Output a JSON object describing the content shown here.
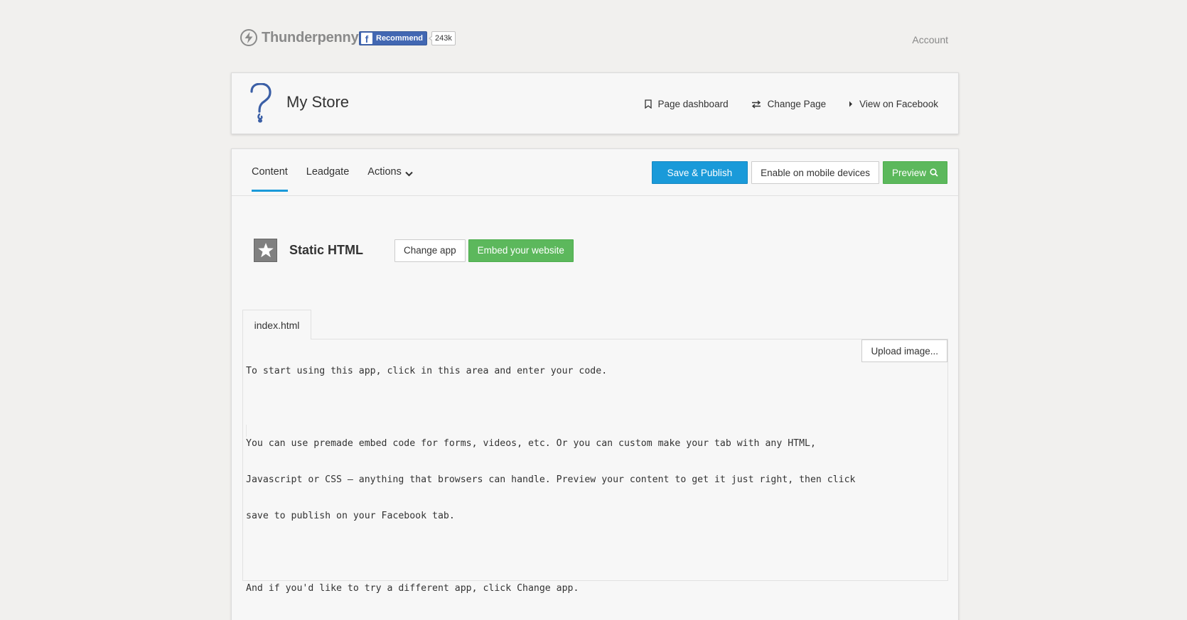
{
  "brand": {
    "name": "Thunderpenny"
  },
  "facebook": {
    "recommend_label": "Recommend",
    "count": "243k"
  },
  "topnav": {
    "account": "Account"
  },
  "page": {
    "store_name": "My Store",
    "nav": [
      {
        "label": "Page dashboard",
        "icon": "bookmark-icon"
      },
      {
        "label": "Change Page",
        "icon": "swap-arrows-icon"
      },
      {
        "label": "View on Facebook",
        "icon": "caret-right-icon"
      }
    ]
  },
  "tabs": {
    "content": "Content",
    "leadgate": "Leadgate",
    "actions": "Actions"
  },
  "toolbar": {
    "save_publish": "Save & Publish",
    "enable_mobile": "Enable on mobile devices",
    "preview": "Preview"
  },
  "app": {
    "name": "Static HTML",
    "change_app": "Change app",
    "embed_website": "Embed your website"
  },
  "editor": {
    "file_tab": "index.html",
    "upload_image": "Upload image...",
    "lines": [
      "To start using this app, click in this area and enter your code.",
      "",
      "You can use premade embed code for forms, videos, etc. Or you can custom make your tab with any HTML,",
      "Javascript or CSS – anything that browsers can handle. Preview your content to get it just right, then click",
      "save to publish on your Facebook tab.",
      "",
      "And if you'd like to try a different app, click Change app."
    ]
  },
  "colors": {
    "accent_blue": "#1a9ad9",
    "green": "#5cb85c",
    "facebook_blue": "#4267b2",
    "background": "#f1f0ee"
  }
}
